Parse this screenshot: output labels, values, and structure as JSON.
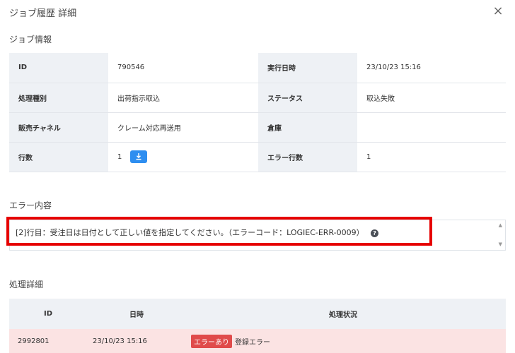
{
  "modal": {
    "title": "ジョブ履歴 詳細",
    "close_glyph": "×"
  },
  "job_info": {
    "section_title": "ジョブ情報",
    "rows": [
      [
        {
          "label": "ID",
          "value": "790546"
        },
        {
          "label": "実行日時",
          "value": "23/10/23 15:16"
        }
      ],
      [
        {
          "label": "処理種別",
          "value": "出荷指示取込"
        },
        {
          "label": "ステータス",
          "value": "取込失敗"
        }
      ],
      [
        {
          "label": "販売チャネル",
          "value": "クレーム対応再送用"
        },
        {
          "label": "倉庫",
          "value": ""
        }
      ],
      [
        {
          "label": "行数",
          "value": "1"
        },
        {
          "label": "エラー行数",
          "value": "1"
        }
      ]
    ]
  },
  "error_section": {
    "section_title": "エラー内容",
    "message": "[2]行目：受注日は日付として正しい値を指定してください。（エラーコード：LOGIEC-ERR-0009）",
    "help_glyph": "?",
    "highlight_color": "#e60000"
  },
  "detail_section": {
    "section_title": "処理詳細",
    "columns": [
      "ID",
      "日時",
      "処理状況"
    ],
    "rows": [
      {
        "id": "2992801",
        "datetime": "23/10/23 15:16",
        "badge": "エラーあり",
        "status": "登録エラー"
      }
    ]
  },
  "colors": {
    "label_bg": "#eef1f5",
    "error_row_bg": "#fbe3e3",
    "badge_bg": "#e04b4b",
    "download_btn_bg": "#2e8ef0"
  }
}
